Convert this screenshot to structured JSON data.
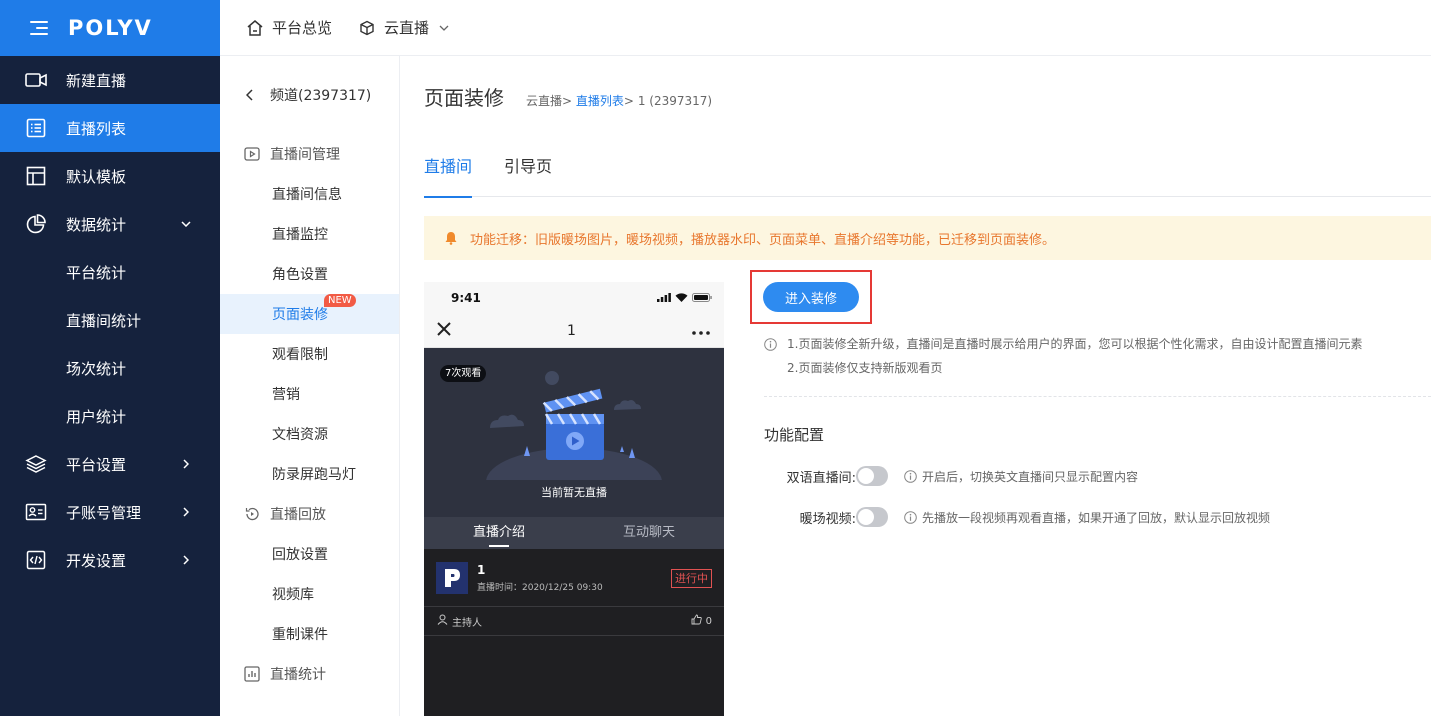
{
  "brand": {
    "logo": "POLYV"
  },
  "sidebar": {
    "items": [
      {
        "label": "新建直播",
        "icon": "video-camera-icon"
      },
      {
        "label": "直播列表",
        "icon": "list-icon",
        "active": true
      },
      {
        "label": "默认模板",
        "icon": "template-icon"
      },
      {
        "label": "数据统计",
        "icon": "pie-chart-icon",
        "expanded": true
      },
      {
        "label": "平台统计"
      },
      {
        "label": "直播间统计"
      },
      {
        "label": "场次统计"
      },
      {
        "label": "用户统计"
      },
      {
        "label": "平台设置",
        "icon": "layers-icon"
      },
      {
        "label": "子账号管理",
        "icon": "user-card-icon"
      },
      {
        "label": "开发设置",
        "icon": "code-icon"
      }
    ]
  },
  "topbar": {
    "overview": "平台总览",
    "cloud_live": "云直播"
  },
  "subnav": {
    "channel": "频道(2397317)",
    "group1": "直播间管理",
    "group1_items": [
      "直播间信息",
      "直播监控",
      "角色设置",
      "页面装修",
      "观看限制",
      "营销",
      "文档资源",
      "防录屏跑马灯"
    ],
    "new_badge": "NEW",
    "group2": "直播回放",
    "group2_items": [
      "回放设置",
      "视频库",
      "重制课件"
    ],
    "group3": "直播统计"
  },
  "main": {
    "title": "页面装修",
    "crumb_1": "云直播",
    "crumb_2": "直播列表",
    "crumb_3": "1 (2397317)",
    "sep": ">",
    "tabs": [
      "直播间",
      "引导页"
    ],
    "notice": "功能迁移：旧版暖场图片，暖场视频，播放器水印、页面菜单、直播介绍等功能，已迁移到页面装修。"
  },
  "phone": {
    "time": "9:41",
    "nav_title": "1",
    "views": "7次观看",
    "no_live": "当前暂无直播",
    "tab_intro": "直播介绍",
    "tab_chat": "互动聊天",
    "live_title": "1",
    "live_time": "直播时间：2020/12/25 09:30",
    "live_status": "进行中",
    "host": "主持人",
    "likes": "0"
  },
  "config": {
    "enter_button": "进入装修",
    "tip1": "1.页面装修全新升级，直播间是直播时展示给用户的界面，您可以根据个性化需求，自由设计配置直播间元素",
    "tip2": "2.页面装修仅支持新版观看页",
    "section_title": "功能配置",
    "bilingual_label": "双语直播间:",
    "bilingual_tip": "开启后，切换英文直播间只显示配置内容",
    "warmup_label": "暖场视频:",
    "warmup_tip": "先播放一段视频再观看直播，如果开通了回放，默认显示回放视频"
  }
}
